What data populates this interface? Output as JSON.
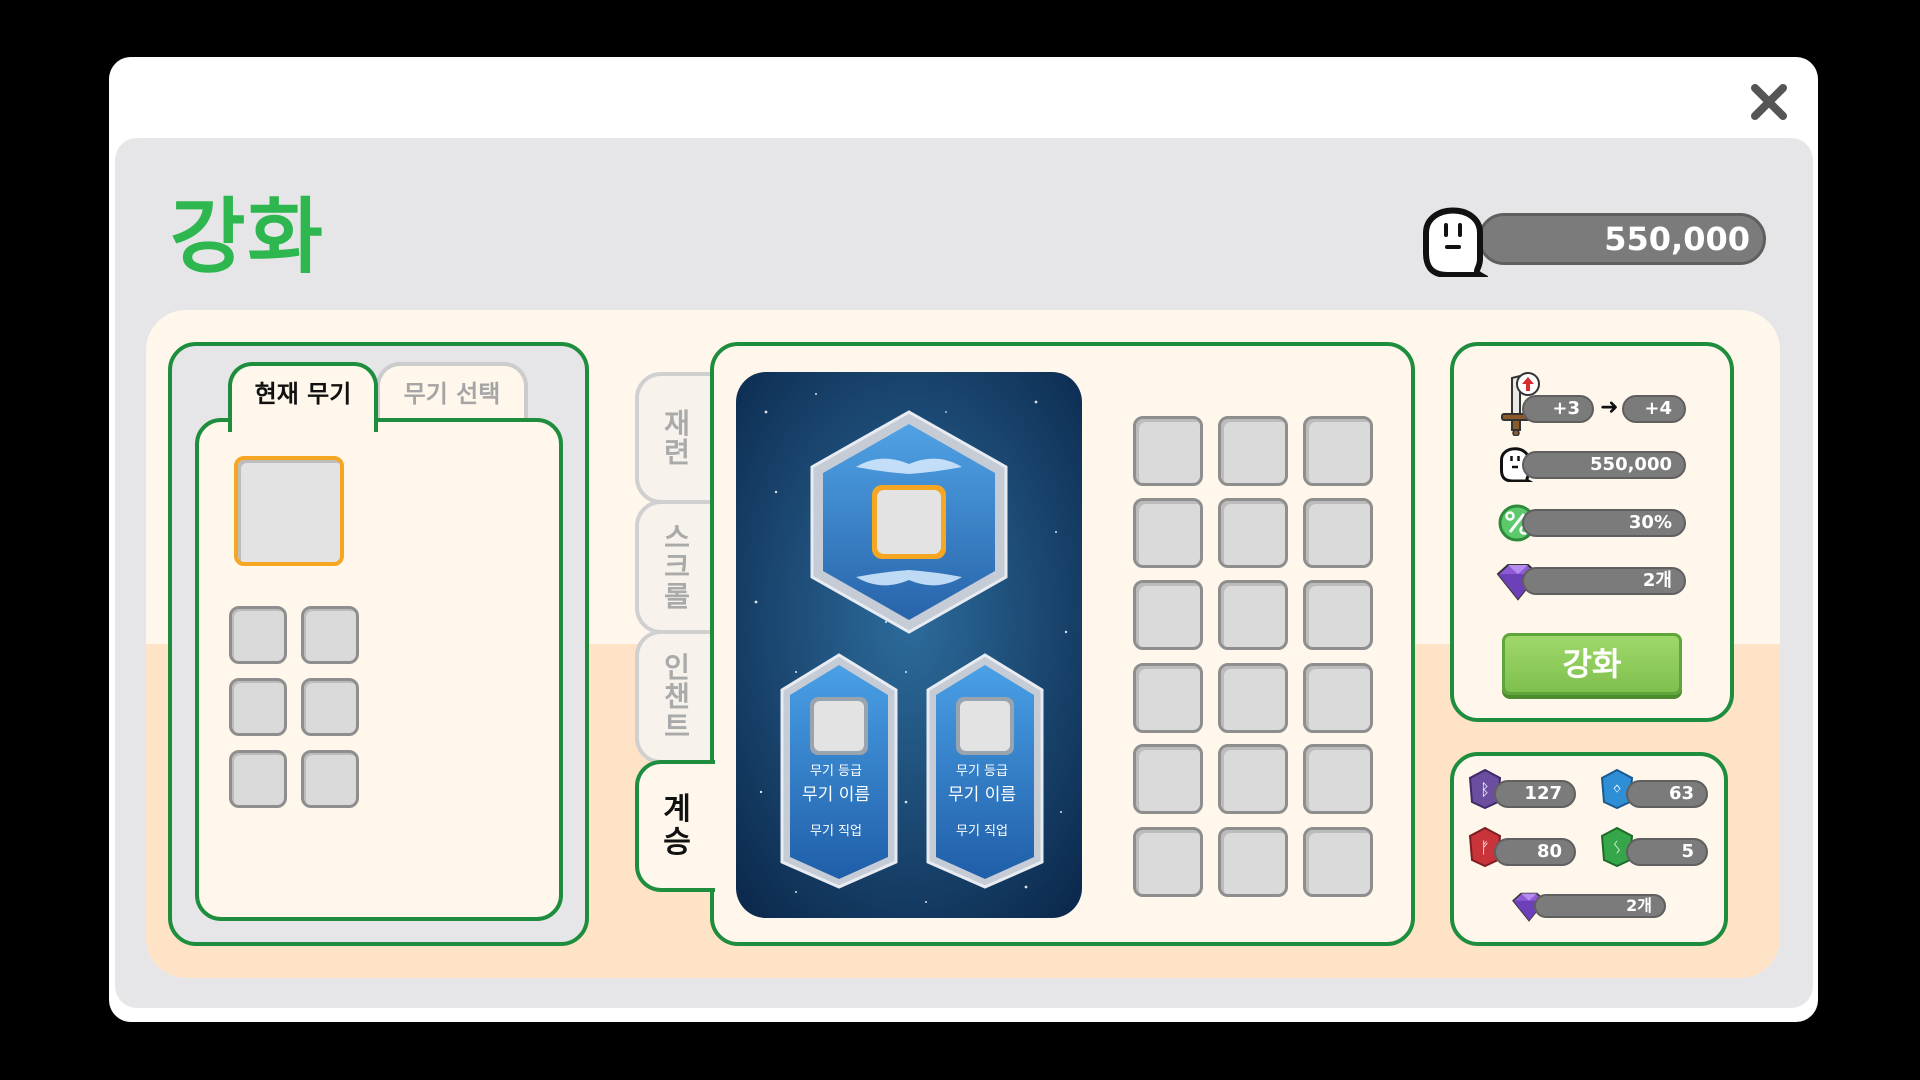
{
  "window": {
    "close_icon": "close-icon"
  },
  "header": {
    "title": "강화",
    "currency_icon": "ghost-icon",
    "currency_value": "550,000"
  },
  "left_panel": {
    "tabs": [
      {
        "label": "현재 무기",
        "active": true
      },
      {
        "label": "무기 선택",
        "active": false
      }
    ]
  },
  "side_tabs": [
    {
      "label": "재련",
      "active": false
    },
    {
      "label": "스크롤",
      "active": false
    },
    {
      "label": "인챈트",
      "active": false
    },
    {
      "label": "계승",
      "active": true
    }
  ],
  "inherit_card": {
    "cards": [
      {
        "grade": "무기 등급",
        "name": "무기 이름",
        "job": "무기 직업"
      },
      {
        "grade": "무기 등급",
        "name": "무기 이름",
        "job": "무기 직업"
      }
    ]
  },
  "enhance_info": {
    "level_from": "+3",
    "level_to": "+4",
    "cost": "550,000",
    "success_rate": "30%",
    "gem_cost": "2개",
    "button_label": "강화"
  },
  "inventory": {
    "runes": [
      {
        "icon": "purple-rune-icon",
        "count": "127",
        "color": "#6b4ea0"
      },
      {
        "icon": "blue-rune-icon",
        "count": "63",
        "color": "#2f8fd6"
      },
      {
        "icon": "red-rune-icon",
        "count": "80",
        "color": "#c9343a"
      },
      {
        "icon": "green-rune-icon",
        "count": "5",
        "color": "#36a64a"
      }
    ],
    "gem_count": "2개"
  },
  "colors": {
    "accent_green": "#1e8e3e",
    "title_green": "#2fb74f",
    "button_green": "#8ccc5a",
    "highlight_orange": "#f5a623"
  }
}
